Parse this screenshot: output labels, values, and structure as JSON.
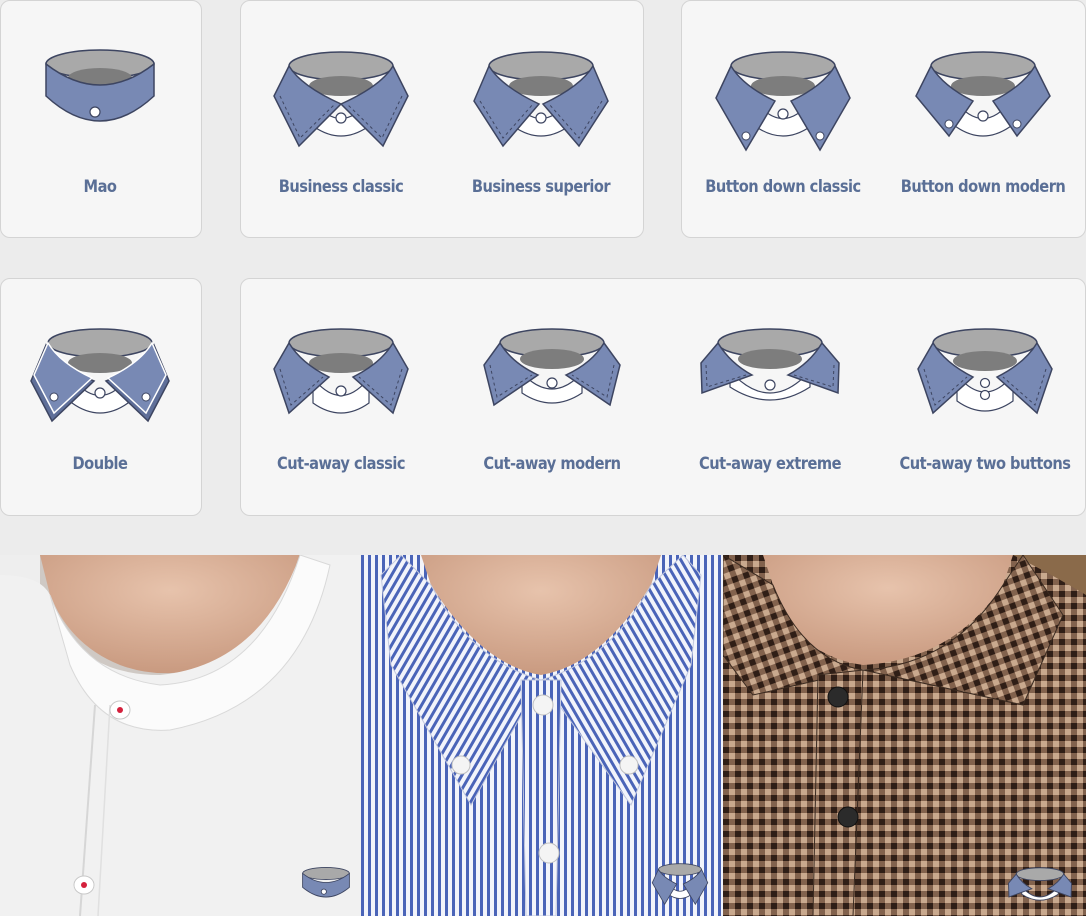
{
  "colors": {
    "collar_blue": "#7889b4",
    "collar_stroke": "#3d4561",
    "inner_gray": "#a9a9a9",
    "inner_dark": "#7d7d7d",
    "label": "#5a6f96",
    "card_bg": "#f6f6f6",
    "page_bg": "#ececec"
  },
  "row1": [
    {
      "label": "Mao",
      "icon": "mao-collar-icon"
    },
    {
      "label": "Business classic",
      "icon": "business-classic-collar-icon"
    },
    {
      "label": "Business superior",
      "icon": "business-superior-collar-icon"
    },
    {
      "label": "Button down classic",
      "icon": "button-down-classic-collar-icon"
    },
    {
      "label": "Button down modern",
      "icon": "button-down-modern-collar-icon"
    }
  ],
  "row2": [
    {
      "label": "Double",
      "icon": "double-collar-icon"
    },
    {
      "label": "Cut-away classic",
      "icon": "cut-away-classic-collar-icon"
    },
    {
      "label": "Cut-away modern",
      "icon": "cut-away-modern-collar-icon"
    },
    {
      "label": "Cut-away extreme",
      "icon": "cut-away-extreme-collar-icon"
    },
    {
      "label": "Cut-away two buttons",
      "icon": "cut-away-two-buttons-collar-icon"
    }
  ],
  "photos": [
    {
      "subject": "white-mao-shirt",
      "badge": "mao-collar-icon"
    },
    {
      "subject": "blue-striped-button-down-shirt",
      "badge": "button-down-collar-icon"
    },
    {
      "subject": "brown-gingham-cut-away-shirt",
      "badge": "cut-away-collar-icon"
    }
  ]
}
